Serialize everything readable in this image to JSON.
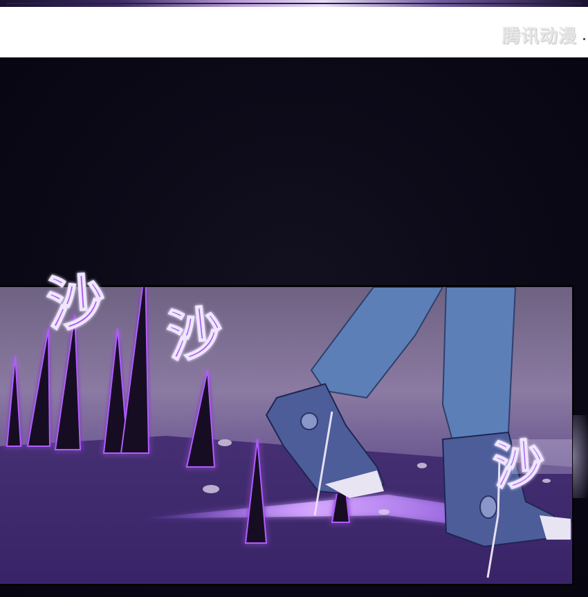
{
  "watermark": {
    "text": "腾讯动漫"
  },
  "sound_effects": [
    {
      "text": "沙"
    },
    {
      "text": "沙"
    },
    {
      "text": "沙"
    }
  ],
  "colors": {
    "energy_purple": "#b25cff",
    "jeans_blue": "#5c7fb8",
    "shoe_blue": "#4d5d9a",
    "panel_floor": "#3b2866",
    "background": "#0a0815"
  }
}
